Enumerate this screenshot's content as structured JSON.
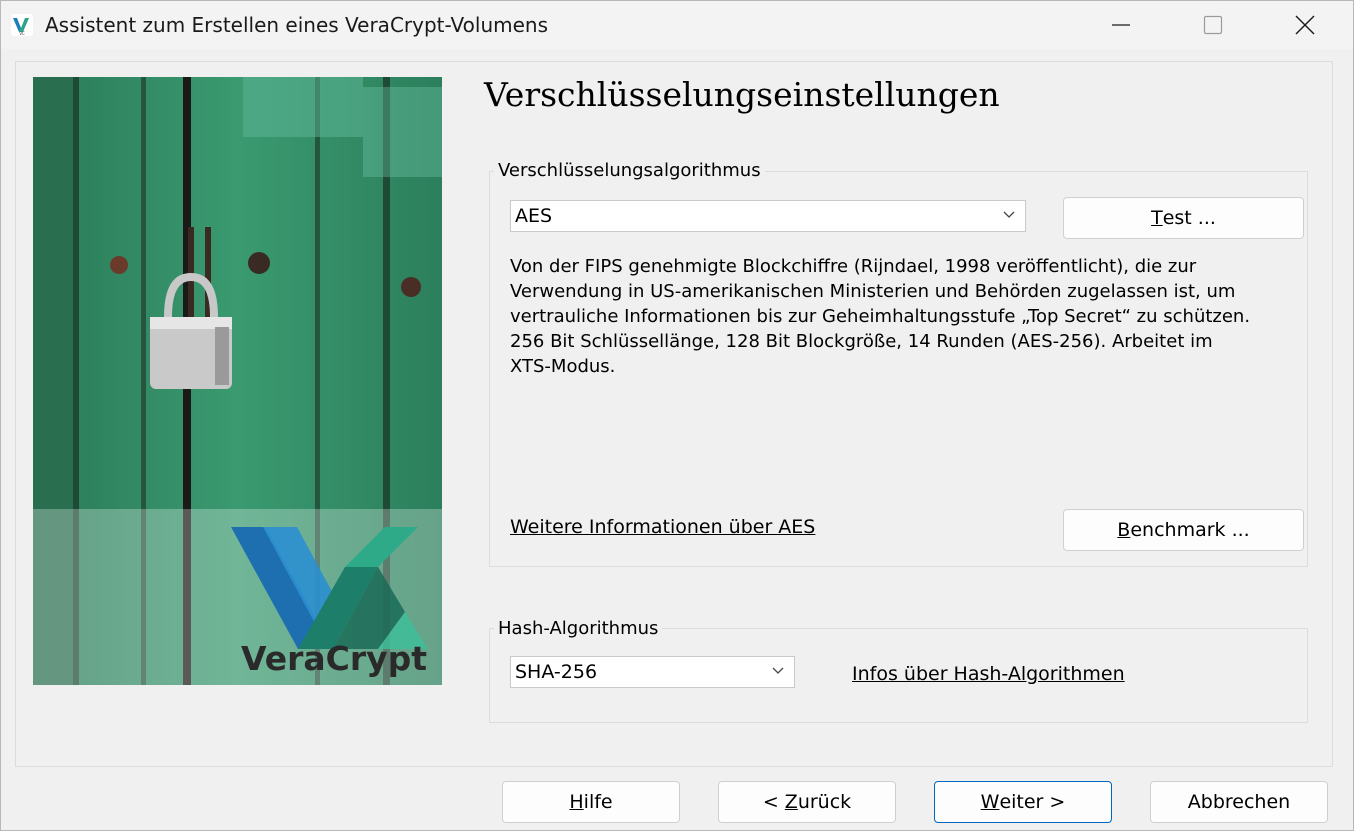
{
  "window": {
    "title": "Assistent zum Erstellen eines VeraCrypt-Volumens"
  },
  "heading": "Verschlüsselungseinstellungen",
  "encryption": {
    "group_label": "Verschlüsselungsalgorithmus",
    "selected": "AES",
    "test_button": {
      "key": "T",
      "rest": "est ..."
    },
    "description_lines": [
      "Von der FIPS genehmigte Blockchiffre (Rijndael, 1998 veröffentlicht), die zur",
      "Verwendung in US-amerikanischen Ministerien und Behörden zugelassen ist, um",
      "vertrauliche Informationen bis zur Geheimhaltungsstufe „Top Secret“ zu schützen.",
      "256 Bit Schlüssellänge, 128 Bit Blockgröße, 14 Runden (AES-256). Arbeitet im",
      "XTS-Modus."
    ],
    "more_info_link": "Weitere Informationen über AES",
    "benchmark_button": {
      "key": "B",
      "rest": "enchmark ..."
    }
  },
  "hash": {
    "group_label": "Hash-Algorithmus",
    "selected": "SHA-256",
    "info_link": "Infos über Hash-Algorithmen"
  },
  "artwork": {
    "logo_text": "VeraCrypt"
  },
  "footer": {
    "help": {
      "key": "H",
      "rest": "ilfe"
    },
    "back": {
      "pre": "< ",
      "key": "Z",
      "rest": "urück"
    },
    "next": {
      "key": "W",
      "rest": "eiter >"
    },
    "cancel": "Abbrechen"
  },
  "colors": {
    "accent": "#0067c0",
    "door_green": "#2f8a63"
  },
  "icons": [
    "veracrypt-app-icon",
    "minimize-icon",
    "maximize-icon",
    "close-icon",
    "chevron-down-icon"
  ]
}
